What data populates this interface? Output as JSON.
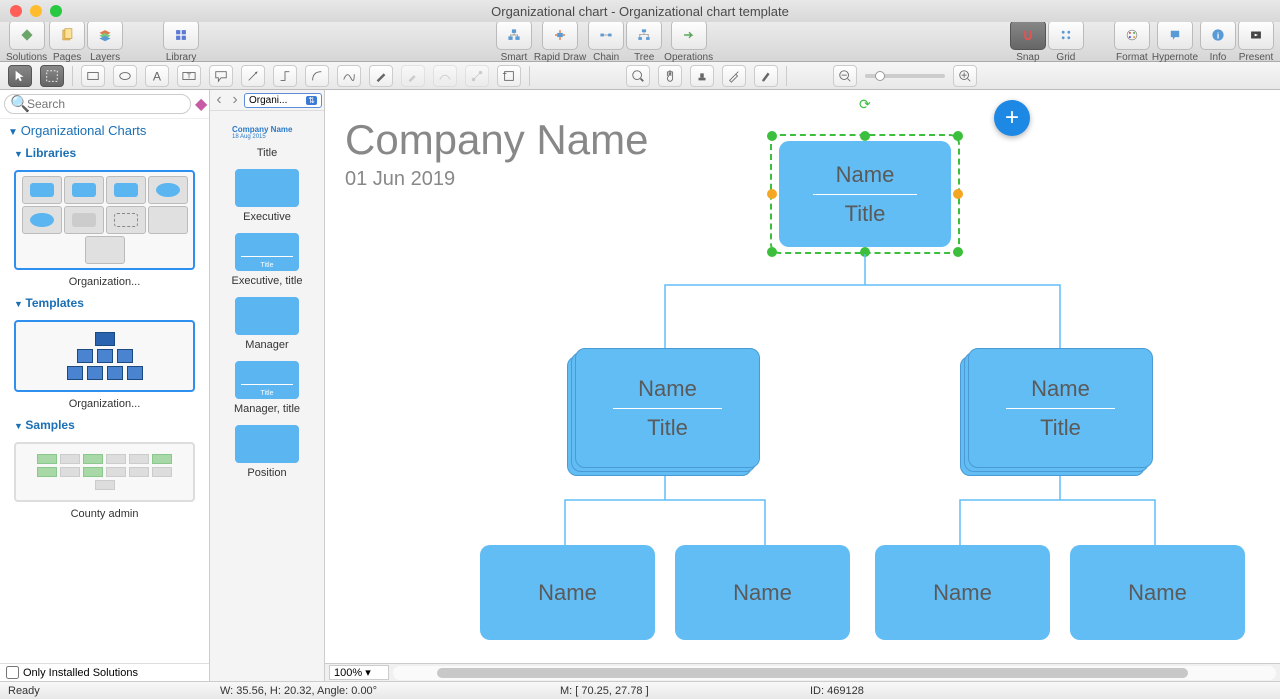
{
  "window": {
    "title": "Organizational chart - Organizational chart template"
  },
  "toolbar": {
    "solutions": "Solutions",
    "pages": "Pages",
    "layers": "Layers",
    "library": "Library",
    "smart": "Smart",
    "rapid": "Rapid Draw",
    "chain": "Chain",
    "tree": "Tree",
    "ops": "Operations",
    "snap": "Snap",
    "grid": "Grid",
    "format": "Format",
    "hypernote": "Hypernote",
    "info": "Info",
    "present": "Present"
  },
  "search": {
    "placeholder": "Search"
  },
  "left": {
    "section": "Organizational Charts",
    "libraries": "Libraries",
    "lib_thumb": "Organization...",
    "templates": "Templates",
    "tpl_thumb": "Organization...",
    "samples": "Samples",
    "sample_thumb": "County admin",
    "only_installed": "Only Installed Solutions"
  },
  "shapes": {
    "selector": "Organi...",
    "items": [
      {
        "label": "Title",
        "type": "title",
        "text1": "Company Name",
        "text2": "18 Aug 2015"
      },
      {
        "label": "Executive",
        "type": "plain"
      },
      {
        "label": "Executive, title",
        "type": "plain-title"
      },
      {
        "label": "Manager",
        "type": "stack"
      },
      {
        "label": "Manager, title",
        "type": "stack-title"
      },
      {
        "label": "Position",
        "type": "plain"
      }
    ]
  },
  "canvas": {
    "company": "Company Name",
    "date": "01 Jun 2019",
    "root": {
      "name": "Name",
      "title": "Title"
    },
    "mid": [
      {
        "name": "Name",
        "title": "Title"
      },
      {
        "name": "Name",
        "title": "Title"
      }
    ],
    "leaves": [
      "Name",
      "Name",
      "Name",
      "Name"
    ],
    "zoom": "100%"
  },
  "status": {
    "ready": "Ready",
    "wh": "W: 35.56,  H: 20.32,  Angle: 0.00°",
    "m": "M: [ 70.25, 27.78 ]",
    "id": "ID: 469128"
  }
}
